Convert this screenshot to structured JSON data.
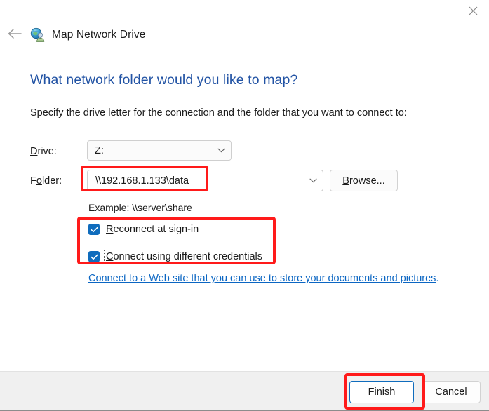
{
  "window": {
    "title": "Map Network Drive",
    "title_icon": "network-drive-globe-icon",
    "close_icon": "close-icon",
    "back_icon": "back-arrow-icon"
  },
  "content": {
    "heading": "What network folder would you like to map?",
    "subheading": "Specify the drive letter for the connection and the folder that you want to connect to:",
    "drive": {
      "label_pre": "D",
      "label_post": "rive:",
      "value": "Z:",
      "chevron_icon": "chevron-down-icon"
    },
    "folder": {
      "label_pre": "F",
      "label_accel": "o",
      "label_post": "lder:",
      "value": "\\\\192.168.1.133\\data",
      "chevron_icon": "chevron-down-icon",
      "browse_pre": "B",
      "browse_post": "rowse..."
    },
    "example": "Example: \\\\server\\share",
    "checkboxes": [
      {
        "name": "reconnect-at-sign-in",
        "accel": "R",
        "label_rest": "econnect at sign-in",
        "checked": true,
        "focused": false
      },
      {
        "name": "connect-using-different-credentials",
        "accel": "C",
        "label_rest": "onnect using different credentials",
        "checked": true,
        "focused": true
      }
    ],
    "weblink": {
      "text": "Connect to a Web site that you can use to store your documents and pictures",
      "trailing": "."
    }
  },
  "footer": {
    "finish_pre": "F",
    "finish_post": "inish",
    "cancel_label": "Cancel"
  },
  "annotations": {
    "color": "#ff1a1a",
    "boxes": [
      "folder-field",
      "checkbox-group",
      "finish-button"
    ]
  },
  "colors": {
    "heading_blue": "#2253a4",
    "link_blue": "#0b66c3",
    "accent_blue": "#0f6cbd",
    "footer_bg": "#f0f0f0",
    "annotation_red": "#ff1a1a"
  }
}
